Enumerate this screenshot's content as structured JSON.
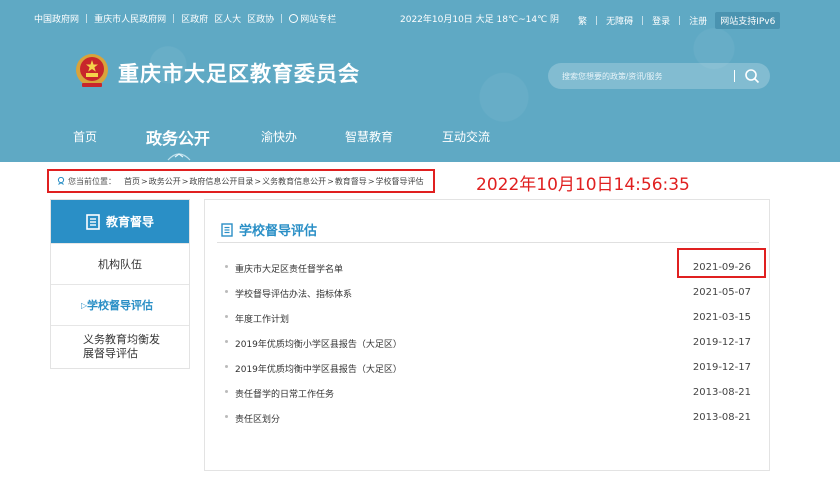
{
  "topbar": {
    "links": [
      "中国政府网",
      "重庆市人民政府网",
      "区政府",
      "区人大",
      "区政协"
    ],
    "site_map": "网站专栏",
    "date": "2022年10月10日  大足 18℃~14℃ 阴",
    "right_links": [
      "繁",
      "无障碍",
      "登录",
      "注册"
    ],
    "ipv6": "网站支持IPv6"
  },
  "header": {
    "title": "重庆市大足区教育委员会",
    "search_placeholder": "搜索您想要的政策/资讯/服务"
  },
  "nav": {
    "items": [
      "首页",
      "政务公开",
      "渝快办",
      "智慧教育",
      "互动交流"
    ]
  },
  "breadcrumb": {
    "label": "您当前位置：",
    "items": [
      "首页",
      "政务公开",
      "政府信息公开目录",
      "义务教育信息公开",
      "教育督导",
      "学校督导评估"
    ],
    "separator": ">"
  },
  "timestamp": "2022年10月10日14:56:35",
  "sidebar": {
    "title": "教育督导",
    "items": [
      "机构队伍",
      "学校督导评估",
      "义务教育均衡发展督导评估"
    ],
    "item3_line1": "义务教育均衡发",
    "item3_line2": "展督导评估",
    "active_marker": "▷"
  },
  "main": {
    "title": "学校督导评估",
    "rows": [
      {
        "title": "重庆市大足区责任督学名单",
        "date": "2021-09-26"
      },
      {
        "title": "学校督导评估办法、指标体系",
        "date": "2021-05-07"
      },
      {
        "title": "年度工作计划",
        "date": "2021-03-15"
      },
      {
        "title": "2019年优质均衡小学区县报告（大足区）",
        "date": "2019-12-17"
      },
      {
        "title": "2019年优质均衡中学区县报告（大足区）",
        "date": "2019-12-17"
      },
      {
        "title": "责任督学的日常工作任务",
        "date": "2013-08-21"
      },
      {
        "title": "责任区划分",
        "date": "2013-08-21"
      }
    ]
  },
  "colors": {
    "header_bg": "#5fa9c4",
    "accent": "#2a8fc6",
    "highlight_red": "#e02020"
  }
}
